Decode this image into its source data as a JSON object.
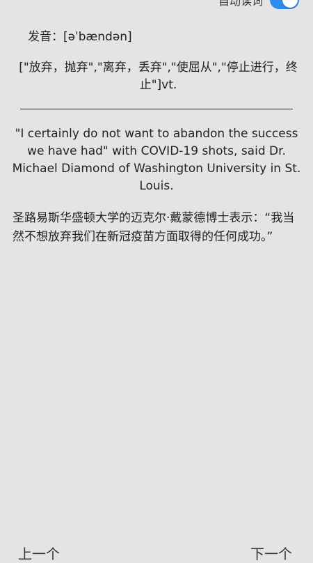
{
  "top_bar": {
    "auto_read_label": "自动读词",
    "auto_read_on": true,
    "accent_color": "#2d8cf0"
  },
  "word": {
    "pronunciation_label": "发音：",
    "phonetic": "[əˈbændən]",
    "meanings": "[\"放弃，抛弃\",\"离弃，丢弃\",\"使屈从\",\"停止进行，终止\"]vt."
  },
  "example": {
    "english": "\"I certainly do not want to abandon the success we have had\" with COVID-19 shots, said Dr. Michael Diamond of Washington University in St. Louis.",
    "chinese": "圣路易斯华盛顿大学的迈克尔·戴蒙德博士表示：“我当然不想放弃我们在新冠疫苗方面取得的任何成功。”"
  },
  "bottom_nav": {
    "prev_label": "上一个",
    "next_label": "下一个"
  }
}
